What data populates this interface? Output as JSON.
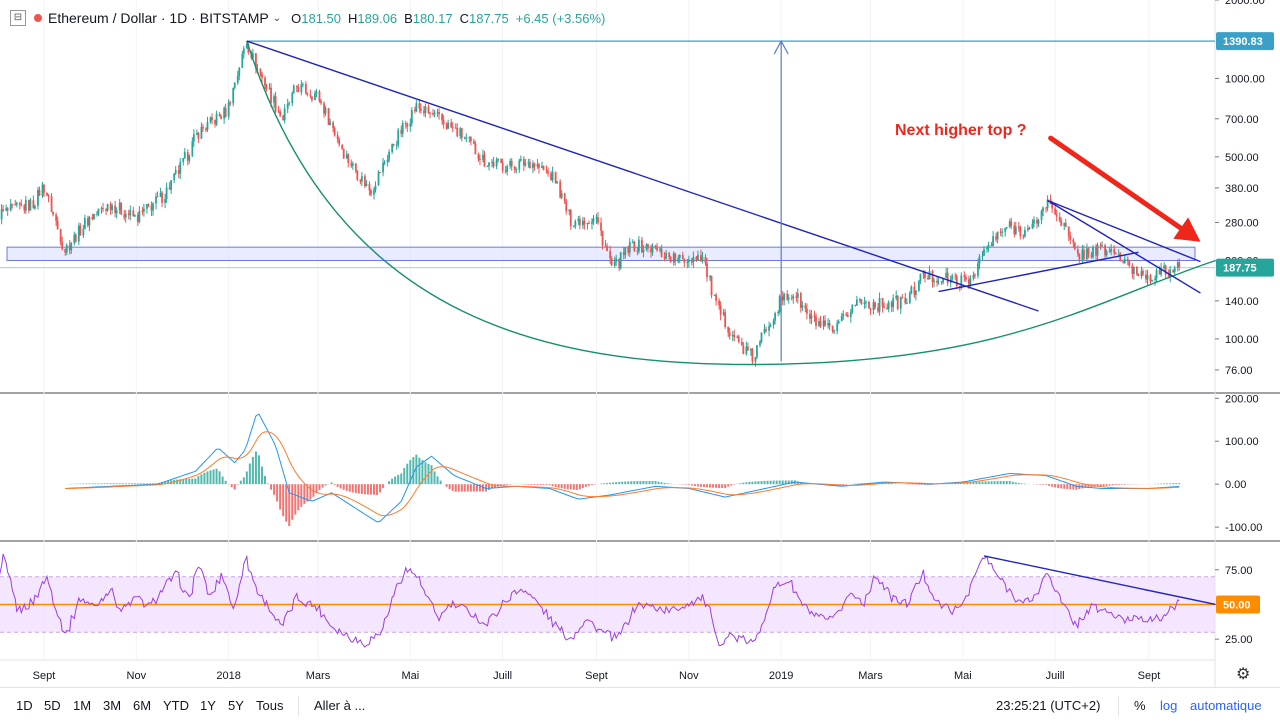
{
  "header": {
    "symbol": "Ethereum / Dollar",
    "interval": "1D",
    "exchange": "BITSTAMP",
    "open_label": "O",
    "open": "181.50",
    "high_label": "H",
    "high": "189.06",
    "low_label": "B",
    "low": "180.17",
    "close_label": "C",
    "close": "187.75",
    "change": "+6.45 (+3.56%)"
  },
  "chart_data": [
    {
      "type": "candlestick",
      "pane": "price",
      "scale": "log",
      "ylim": [
        62,
        2000
      ],
      "y_ticks": [
        "2000.00",
        "1000.00",
        "700.00",
        "500.00",
        "380.00",
        "280.00",
        "200.00",
        "140.00",
        "100.00",
        "76.00"
      ],
      "price_badges": [
        "1390.83",
        "187.75"
      ],
      "annotation": "Next higher top ?",
      "close_path": [
        [
          "2017-08-01",
          300
        ],
        [
          "2017-08-25",
          330
        ],
        [
          "2017-09-01",
          390
        ],
        [
          "2017-09-15",
          220
        ],
        [
          "2017-10-01",
          290
        ],
        [
          "2017-10-15",
          330
        ],
        [
          "2017-11-01",
          290
        ],
        [
          "2017-11-20",
          360
        ],
        [
          "2017-12-01",
          460
        ],
        [
          "2017-12-12",
          620
        ],
        [
          "2017-12-31",
          750
        ],
        [
          "2018-01-13",
          1390
        ],
        [
          "2018-01-20",
          1100
        ],
        [
          "2018-02-06",
          700
        ],
        [
          "2018-02-15",
          930
        ],
        [
          "2018-03-01",
          860
        ],
        [
          "2018-03-20",
          500
        ],
        [
          "2018-04-05",
          370
        ],
        [
          "2018-04-20",
          560
        ],
        [
          "2018-05-05",
          780
        ],
        [
          "2018-05-20",
          700
        ],
        [
          "2018-06-05",
          600
        ],
        [
          "2018-06-20",
          480
        ],
        [
          "2018-07-05",
          460
        ],
        [
          "2018-07-20",
          480
        ],
        [
          "2018-08-05",
          410
        ],
        [
          "2018-08-15",
          285
        ],
        [
          "2018-09-01",
          290
        ],
        [
          "2018-09-12",
          185
        ],
        [
          "2018-09-25",
          230
        ],
        [
          "2018-10-10",
          220
        ],
        [
          "2018-10-25",
          200
        ],
        [
          "2018-11-10",
          210
        ],
        [
          "2018-11-20",
          130
        ],
        [
          "2018-12-05",
          95
        ],
        [
          "2018-12-14",
          84
        ],
        [
          "2018-12-22",
          110
        ],
        [
          "2019-01-01",
          140
        ],
        [
          "2019-01-10",
          150
        ],
        [
          "2019-01-20",
          120
        ],
        [
          "2019-02-05",
          105
        ],
        [
          "2019-02-20",
          140
        ],
        [
          "2019-03-05",
          135
        ],
        [
          "2019-03-25",
          140
        ],
        [
          "2019-04-05",
          175
        ],
        [
          "2019-04-20",
          170
        ],
        [
          "2019-05-05",
          165
        ],
        [
          "2019-05-15",
          215
        ],
        [
          "2019-05-30",
          270
        ],
        [
          "2019-06-15",
          260
        ],
        [
          "2019-06-26",
          335
        ],
        [
          "2019-07-05",
          290
        ],
        [
          "2019-07-15",
          210
        ],
        [
          "2019-07-30",
          220
        ],
        [
          "2019-08-10",
          215
        ],
        [
          "2019-08-20",
          185
        ],
        [
          "2019-09-01",
          175
        ],
        [
          "2019-09-10",
          180
        ],
        [
          "2019-09-22",
          187.75
        ]
      ],
      "drawings": {
        "horizontal_ray": {
          "price": 1390.83
        },
        "support_zone": [
          200,
          225
        ],
        "price_line": 187.75,
        "measure_arrow": {
          "date": "2019-01-01",
          "from": 82,
          "to": 1390.83
        },
        "downtrend_1": [
          [
            "2018-01-13",
            1390.83
          ],
          [
            "2019-06-20",
            128
          ]
        ],
        "uptrend_1": [
          [
            "2019-04-15",
            152
          ],
          [
            "2019-08-25",
            215
          ]
        ],
        "wedge_upper": [
          [
            "2019-06-26",
            340
          ],
          [
            "2019-10-05",
            198
          ]
        ],
        "wedge_lower": [
          [
            "2019-06-26",
            340
          ],
          [
            "2019-10-05",
            150
          ]
        ],
        "cup_curve": {
          "start": [
            "2018-01-13",
            1390.83
          ],
          "bottom": [
            "2019-01-01",
            80
          ],
          "end": [
            "2019-10-15",
            200
          ]
        },
        "red_arrow": [
          [
            "2019-06-28",
            590
          ],
          [
            "2019-10-05",
            236
          ]
        ]
      }
    },
    {
      "type": "macd",
      "pane": "macd",
      "ylim": [
        -130,
        210
      ],
      "y_ticks": [
        "200.00",
        "100.00",
        "0.00",
        "-100.00"
      ],
      "macd_path": [
        [
          "2017-09-15",
          -10
        ],
        [
          "2017-10-15",
          -5
        ],
        [
          "2017-11-15",
          0
        ],
        [
          "2017-12-10",
          30
        ],
        [
          "2017-12-25",
          85
        ],
        [
          "2018-01-05",
          50
        ],
        [
          "2018-01-12",
          80
        ],
        [
          "2018-01-20",
          170
        ],
        [
          "2018-02-01",
          90
        ],
        [
          "2018-02-10",
          -20
        ],
        [
          "2018-02-25",
          -40
        ],
        [
          "2018-03-10",
          -20
        ],
        [
          "2018-04-01",
          -70
        ],
        [
          "2018-04-10",
          -90
        ],
        [
          "2018-04-25",
          -40
        ],
        [
          "2018-05-05",
          40
        ],
        [
          "2018-05-15",
          65
        ],
        [
          "2018-05-30",
          20
        ],
        [
          "2018-06-20",
          -10
        ],
        [
          "2018-07-10",
          -5
        ],
        [
          "2018-08-01",
          -10
        ],
        [
          "2018-08-20",
          -35
        ],
        [
          "2018-09-10",
          -25
        ],
        [
          "2018-10-10",
          -5
        ],
        [
          "2018-11-01",
          -10
        ],
        [
          "2018-11-25",
          -30
        ],
        [
          "2018-12-15",
          -15
        ],
        [
          "2019-01-10",
          5
        ],
        [
          "2019-02-10",
          -5
        ],
        [
          "2019-03-10",
          5
        ],
        [
          "2019-04-10",
          0
        ],
        [
          "2019-05-01",
          5
        ],
        [
          "2019-06-01",
          25
        ],
        [
          "2019-06-25",
          20
        ],
        [
          "2019-07-15",
          -5
        ],
        [
          "2019-08-01",
          -10
        ],
        [
          "2019-09-01",
          -10
        ],
        [
          "2019-09-22",
          -5
        ]
      ]
    },
    {
      "type": "rsi",
      "pane": "rsi",
      "ylim": [
        10,
        95
      ],
      "y_ticks": [
        "75.00",
        "25.00"
      ],
      "band": [
        30,
        70
      ],
      "midline": 50,
      "midline_badge": "50.00",
      "rsi_path": [
        [
          "2017-08-01",
          55
        ],
        [
          "2017-08-05",
          85
        ],
        [
          "2017-08-15",
          45
        ],
        [
          "2017-08-25",
          52
        ],
        [
          "2017-09-03",
          70
        ],
        [
          "2017-09-12",
          38
        ],
        [
          "2017-09-16",
          28
        ],
        [
          "2017-09-25",
          55
        ],
        [
          "2017-10-05",
          48
        ],
        [
          "2017-10-15",
          62
        ],
        [
          "2017-10-22",
          45
        ],
        [
          "2017-11-01",
          55
        ],
        [
          "2017-11-10",
          48
        ],
        [
          "2017-11-20",
          63
        ],
        [
          "2017-11-28",
          72
        ],
        [
          "2017-12-06",
          52
        ],
        [
          "2017-12-12",
          80
        ],
        [
          "2017-12-20",
          55
        ],
        [
          "2017-12-28",
          72
        ],
        [
          "2018-01-05",
          45
        ],
        [
          "2018-01-12",
          85
        ],
        [
          "2018-01-20",
          60
        ],
        [
          "2018-01-28",
          48
        ],
        [
          "2018-02-05",
          33
        ],
        [
          "2018-02-15",
          55
        ],
        [
          "2018-03-01",
          48
        ],
        [
          "2018-03-10",
          35
        ],
        [
          "2018-03-20",
          28
        ],
        [
          "2018-04-01",
          22
        ],
        [
          "2018-04-12",
          30
        ],
        [
          "2018-04-22",
          62
        ],
        [
          "2018-04-28",
          75
        ],
        [
          "2018-05-05",
          72
        ],
        [
          "2018-05-12",
          55
        ],
        [
          "2018-05-20",
          40
        ],
        [
          "2018-05-28",
          50
        ],
        [
          "2018-06-10",
          45
        ],
        [
          "2018-06-20",
          35
        ],
        [
          "2018-07-05",
          55
        ],
        [
          "2018-07-15",
          62
        ],
        [
          "2018-07-25",
          50
        ],
        [
          "2018-08-05",
          35
        ],
        [
          "2018-08-15",
          25
        ],
        [
          "2018-08-25",
          40
        ],
        [
          "2018-09-05",
          30
        ],
        [
          "2018-09-15",
          25
        ],
        [
          "2018-09-28",
          50
        ],
        [
          "2018-10-10",
          48
        ],
        [
          "2018-10-20",
          45
        ],
        [
          "2018-10-30",
          50
        ],
        [
          "2018-11-10",
          55
        ],
        [
          "2018-11-15",
          45
        ],
        [
          "2018-11-20",
          22
        ],
        [
          "2018-11-28",
          28
        ],
        [
          "2018-12-05",
          25
        ],
        [
          "2018-12-15",
          22
        ],
        [
          "2018-12-22",
          45
        ],
        [
          "2018-12-28",
          62
        ],
        [
          "2019-01-06",
          68
        ],
        [
          "2019-01-15",
          50
        ],
        [
          "2019-01-25",
          40
        ],
        [
          "2019-02-05",
          38
        ],
        [
          "2019-02-15",
          58
        ],
        [
          "2019-02-25",
          52
        ],
        [
          "2019-03-05",
          72
        ],
        [
          "2019-03-15",
          55
        ],
        [
          "2019-03-25",
          50
        ],
        [
          "2019-04-05",
          72
        ],
        [
          "2019-04-15",
          50
        ],
        [
          "2019-04-28",
          45
        ],
        [
          "2019-05-05",
          60
        ],
        [
          "2019-05-15",
          85
        ],
        [
          "2019-05-28",
          65
        ],
        [
          "2019-06-10",
          50
        ],
        [
          "2019-06-20",
          58
        ],
        [
          "2019-06-26",
          75
        ],
        [
          "2019-07-05",
          52
        ],
        [
          "2019-07-15",
          35
        ],
        [
          "2019-07-25",
          48
        ],
        [
          "2019-08-05",
          45
        ],
        [
          "2019-08-15",
          38
        ],
        [
          "2019-08-25",
          42
        ],
        [
          "2019-09-05",
          38
        ],
        [
          "2019-09-15",
          45
        ],
        [
          "2019-09-22",
          52
        ]
      ],
      "trendline": [
        [
          "2019-05-15",
          85
        ],
        [
          "2019-10-15",
          50
        ]
      ]
    }
  ],
  "time_axis": [
    {
      "label": "Sept",
      "date": "2017-09-01"
    },
    {
      "label": "Nov",
      "date": "2017-11-01"
    },
    {
      "label": "2018",
      "date": "2018-01-01"
    },
    {
      "label": "Mars",
      "date": "2018-03-01"
    },
    {
      "label": "Mai",
      "date": "2018-05-01"
    },
    {
      "label": "Juill",
      "date": "2018-07-01"
    },
    {
      "label": "Sept",
      "date": "2018-09-01"
    },
    {
      "label": "Nov",
      "date": "2018-11-01"
    },
    {
      "label": "2019",
      "date": "2019-01-01"
    },
    {
      "label": "Mars",
      "date": "2019-03-01"
    },
    {
      "label": "Mai",
      "date": "2019-05-01"
    },
    {
      "label": "Juill",
      "date": "2019-07-01"
    },
    {
      "label": "Sept",
      "date": "2019-09-01"
    }
  ],
  "colors": {
    "up": "#26a69a",
    "down": "#ef5350",
    "trend_blue": "#1e22c4",
    "curve_green": "#15906c",
    "macd_line": "#2196f3",
    "signal_line": "#ff7b2d",
    "rsi_line": "#9c3ee0",
    "rsi_mid": "#ff8c00",
    "annotation_red": "#f0261b",
    "zone": "#dbe0ff",
    "ray": "#3aa0c8"
  },
  "toolbar": {
    "timeframes": [
      "1D",
      "5D",
      "1M",
      "3M",
      "6M",
      "YTD",
      "1Y",
      "5Y",
      "Tous"
    ],
    "goto": "Aller à ...",
    "clock": "23:25:21 (UTC+2)",
    "percent": "%",
    "log": "log",
    "auto": "automatique"
  }
}
